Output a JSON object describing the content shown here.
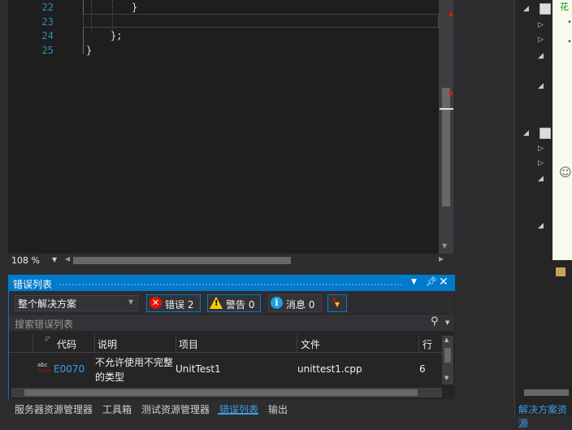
{
  "editor": {
    "lines": [
      {
        "num": "22",
        "code": "}"
      },
      {
        "num": "23",
        "code": ""
      },
      {
        "num": "24",
        "code": "};"
      },
      {
        "num": "25",
        "code": "}"
      }
    ],
    "zoom": "108 %"
  },
  "error_list": {
    "title": "错误列表",
    "scope": "整个解决方案",
    "errors_label": "错误 2",
    "warnings_label": "警告 0",
    "messages_label": "消息 0",
    "search_placeholder": "搜索错误列表",
    "columns": [
      "代码",
      "说明",
      "项目",
      "文件",
      "行"
    ],
    "rows": [
      {
        "code": "E0070",
        "description": "不允许使用不完整的类型",
        "description_line1": "不允许使用不完整",
        "description_line2": "的类型",
        "project": "UnitTest1",
        "file": "unittest1.cpp",
        "line": "6"
      }
    ]
  },
  "bottom_tabs": [
    "服务器资源管理器",
    "工具箱",
    "测试资源管理器",
    "错误列表",
    "输出"
  ],
  "active_tab": "错误列表",
  "right_panel": {
    "note_text": "花",
    "bottom_tab": "解决方案资源"
  },
  "colors": {
    "accent": "#007acc",
    "error": "#e51400",
    "warning": "#ffcc00",
    "info": "#1ba1e2"
  }
}
